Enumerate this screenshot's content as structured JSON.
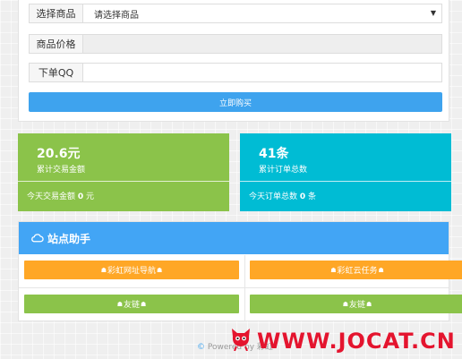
{
  "order_form": {
    "product_label": "选择商品",
    "product_value": "请选择商品",
    "price_label": "商品价格",
    "price_value": "",
    "qq_label": "下单QQ",
    "qq_value": "",
    "buy_button": "立即购买"
  },
  "stats": {
    "trade": {
      "value": "20.6元",
      "caption": "累计交易金额",
      "today_label": "今天交易金额",
      "today_value": "0",
      "today_unit": "元",
      "color": "#8bc34a"
    },
    "orders": {
      "value": "41条",
      "caption": "累计订单总数",
      "today_label": "今天订单总数",
      "today_value": "0",
      "today_unit": "条",
      "color": "#00bcd4"
    }
  },
  "helper": {
    "title": "站点助手",
    "icon": "cloud-icon",
    "links": [
      {
        "label": "彩虹网址导航",
        "color": "#ffa726"
      },
      {
        "label": "彩虹云任务",
        "color": "#ffa726"
      },
      {
        "label": "友链",
        "color": "#8bc34a"
      },
      {
        "label": "友链",
        "color": "#8bc34a"
      }
    ]
  },
  "footer": {
    "copyright_symbol": "©",
    "text": "Powered by 彩虹"
  },
  "watermark": {
    "text": "WWW.JOCAT.CN"
  },
  "colors": {
    "primary": "#3ea3ee",
    "header_blue": "#42a5f5",
    "watermark_red": "#e4142e"
  }
}
